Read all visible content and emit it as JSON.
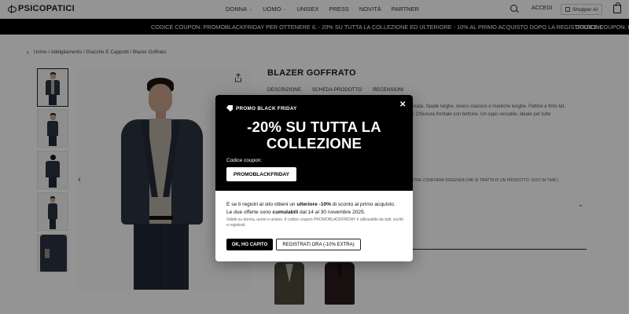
{
  "header": {
    "logo": "PSICOPATICI",
    "nav": [
      "DONNA",
      "UOMO",
      "UNISEX",
      "PRESS",
      "NOVITÀ",
      "PARTNER"
    ],
    "login": "ACCEDI",
    "shopper": "Shopper AI"
  },
  "marquee": {
    "text": "CODICE COUPON: PROMOBLACKFRIDAY PER OTTENERE IL - 20% SU TUTTA LA COLLEZIONE ED ULTERIORE - 10% AL PRIMO ACQUISTO DOPO LA REGISTRAZIONE",
    "text_repeat": "CODICE COUPON: PROMOBLACKFRIDAY"
  },
  "breadcrumb": {
    "text": "Uomo / Abbigliamento / Giacche E Cappotti / Blazer Goffrato"
  },
  "product": {
    "title": "BLAZER GOFFRATO",
    "tabs": [
      "DESCRIZIONE",
      "SCHEDA PRODOTTO",
      "RECENSIONI"
    ],
    "desc_fragments": [
      "pinstriscata. Spalle larghe, revers classico e maniche lunghe. Pattine e finto taf,",
      "legami. Chiusura frontale con bottone. Un capo versatile, ideale per tutte",
      "LE NOSTRE CONFORMI (RIGENDA CHE SI TRATTA DI UN PRODOTTO 'JUST IN TIME')."
    ]
  },
  "modal": {
    "tag": "PROMO BLACK FRIDAY",
    "headline_1": "-20% SU TUTTA LA",
    "headline_2": "COLLEZIONE",
    "coupon_label": "Codice coupon:",
    "coupon_code": "PROMOBLACKFRIDAY",
    "body_1": "E se ti registri al sito ottieni un ",
    "body_bold_1": "ulteriore -10%",
    "body_2": " di sconto al primo acquisto.",
    "body_3": "Le due offerte sono ",
    "body_bold_2": "cumulabili",
    "body_4": " dal 14 al 30 novembre 2025.",
    "fine": "Valido su donna, uomo e unisex. Il codice coupon PROMOBLACKFRIDAY è utilizzabile da tutti, iscritti e registrati.",
    "ok_button": "OK, HO CAPITO",
    "register_button": "REGISTRATI ORA (-10% EXTRA)",
    "close_glyph": "✕"
  },
  "icons": {
    "share": "share-icon",
    "search": "search-icon",
    "cart": "cart-icon"
  }
}
